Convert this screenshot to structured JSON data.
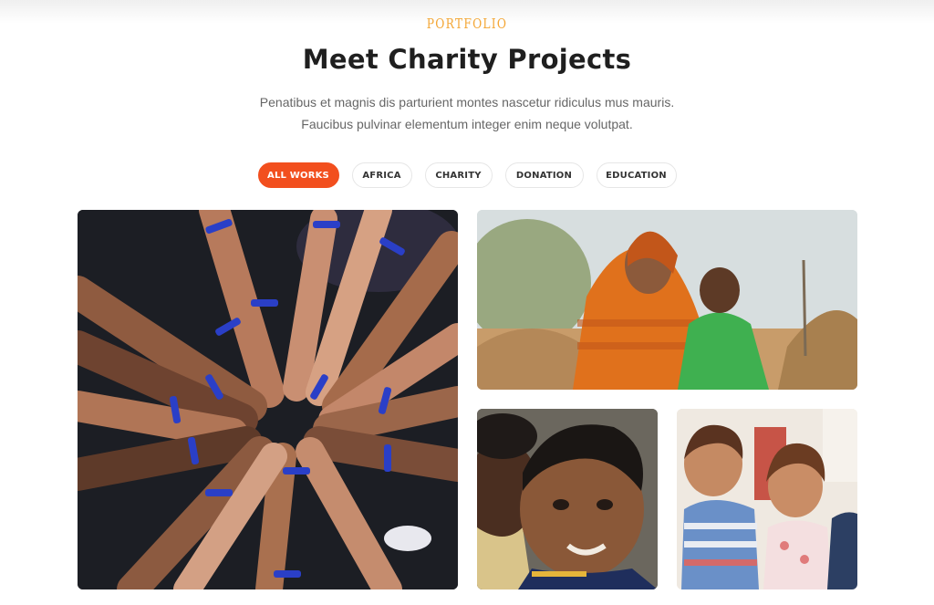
{
  "section": {
    "eyebrow": "PORTFOLIO",
    "title": "Meet Charity Projects",
    "description_line1": "Penatibus et magnis dis parturient montes nascetur ridiculus mus mauris.",
    "description_line2": "Faucibus pulvinar elementum integer enim neque volutpat."
  },
  "filters": [
    {
      "label": "ALL WORKS",
      "active": true
    },
    {
      "label": "AFRICA",
      "active": false
    },
    {
      "label": "CHARITY",
      "active": false
    },
    {
      "label": "DONATION",
      "active": false
    },
    {
      "label": "EDUCATION",
      "active": false
    }
  ],
  "colors": {
    "accent": "#f24f1e",
    "eyebrow": "#f4a634",
    "title": "#1f1f1f",
    "body_text": "#666666"
  },
  "gallery": [
    {
      "id": "hands",
      "depicts": "many hands wearing blue wristbands joined in a circle"
    },
    {
      "id": "woman",
      "depicts": "smiling woman in orange scarf holding a baby"
    },
    {
      "id": "boy",
      "depicts": "close-up of smiling boy looking at camera"
    },
    {
      "id": "girls",
      "depicts": "two young girls in striped shirts"
    }
  ]
}
